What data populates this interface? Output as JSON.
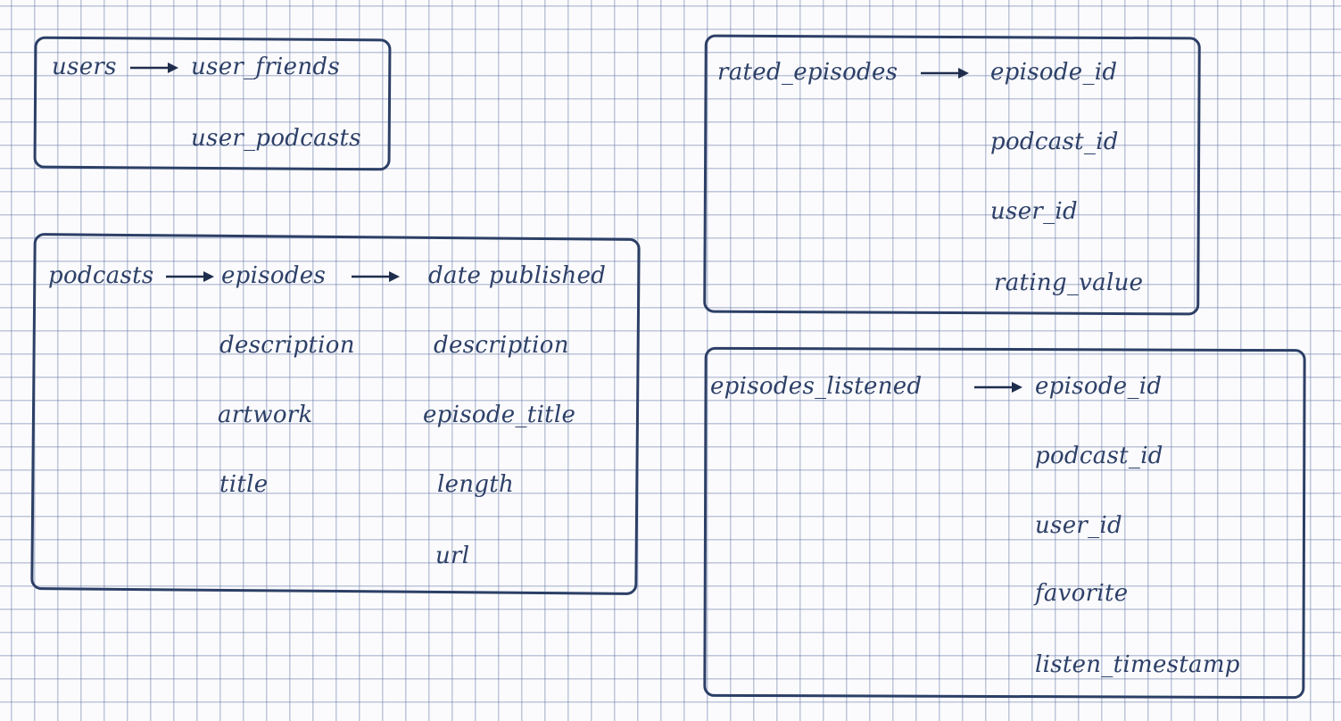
{
  "tables": {
    "users": {
      "name": "users",
      "fields": [
        "user_friends",
        "user_podcasts"
      ]
    },
    "podcasts": {
      "name": "podcasts",
      "fields": [
        "episodes",
        "description",
        "artwork",
        "title"
      ],
      "episodes": {
        "name": "episodes",
        "fields": [
          "date published",
          "description",
          "episode_title",
          "length",
          "url"
        ]
      }
    },
    "rated_episodes": {
      "name": "rated_episodes",
      "fields": [
        "episode_id",
        "podcast_id",
        "user_id",
        "rating_value"
      ]
    },
    "episodes_listened": {
      "name": "episodes_listened",
      "fields": [
        "episode_id",
        "podcast_id",
        "user_id",
        "favorite",
        "listen_timestamp"
      ]
    }
  },
  "colors": {
    "ink": "#2c3f66",
    "grid": "#5a6ea0",
    "paper": "#fbfbfd"
  },
  "icons": {
    "arrow": "right-arrow-icon"
  }
}
